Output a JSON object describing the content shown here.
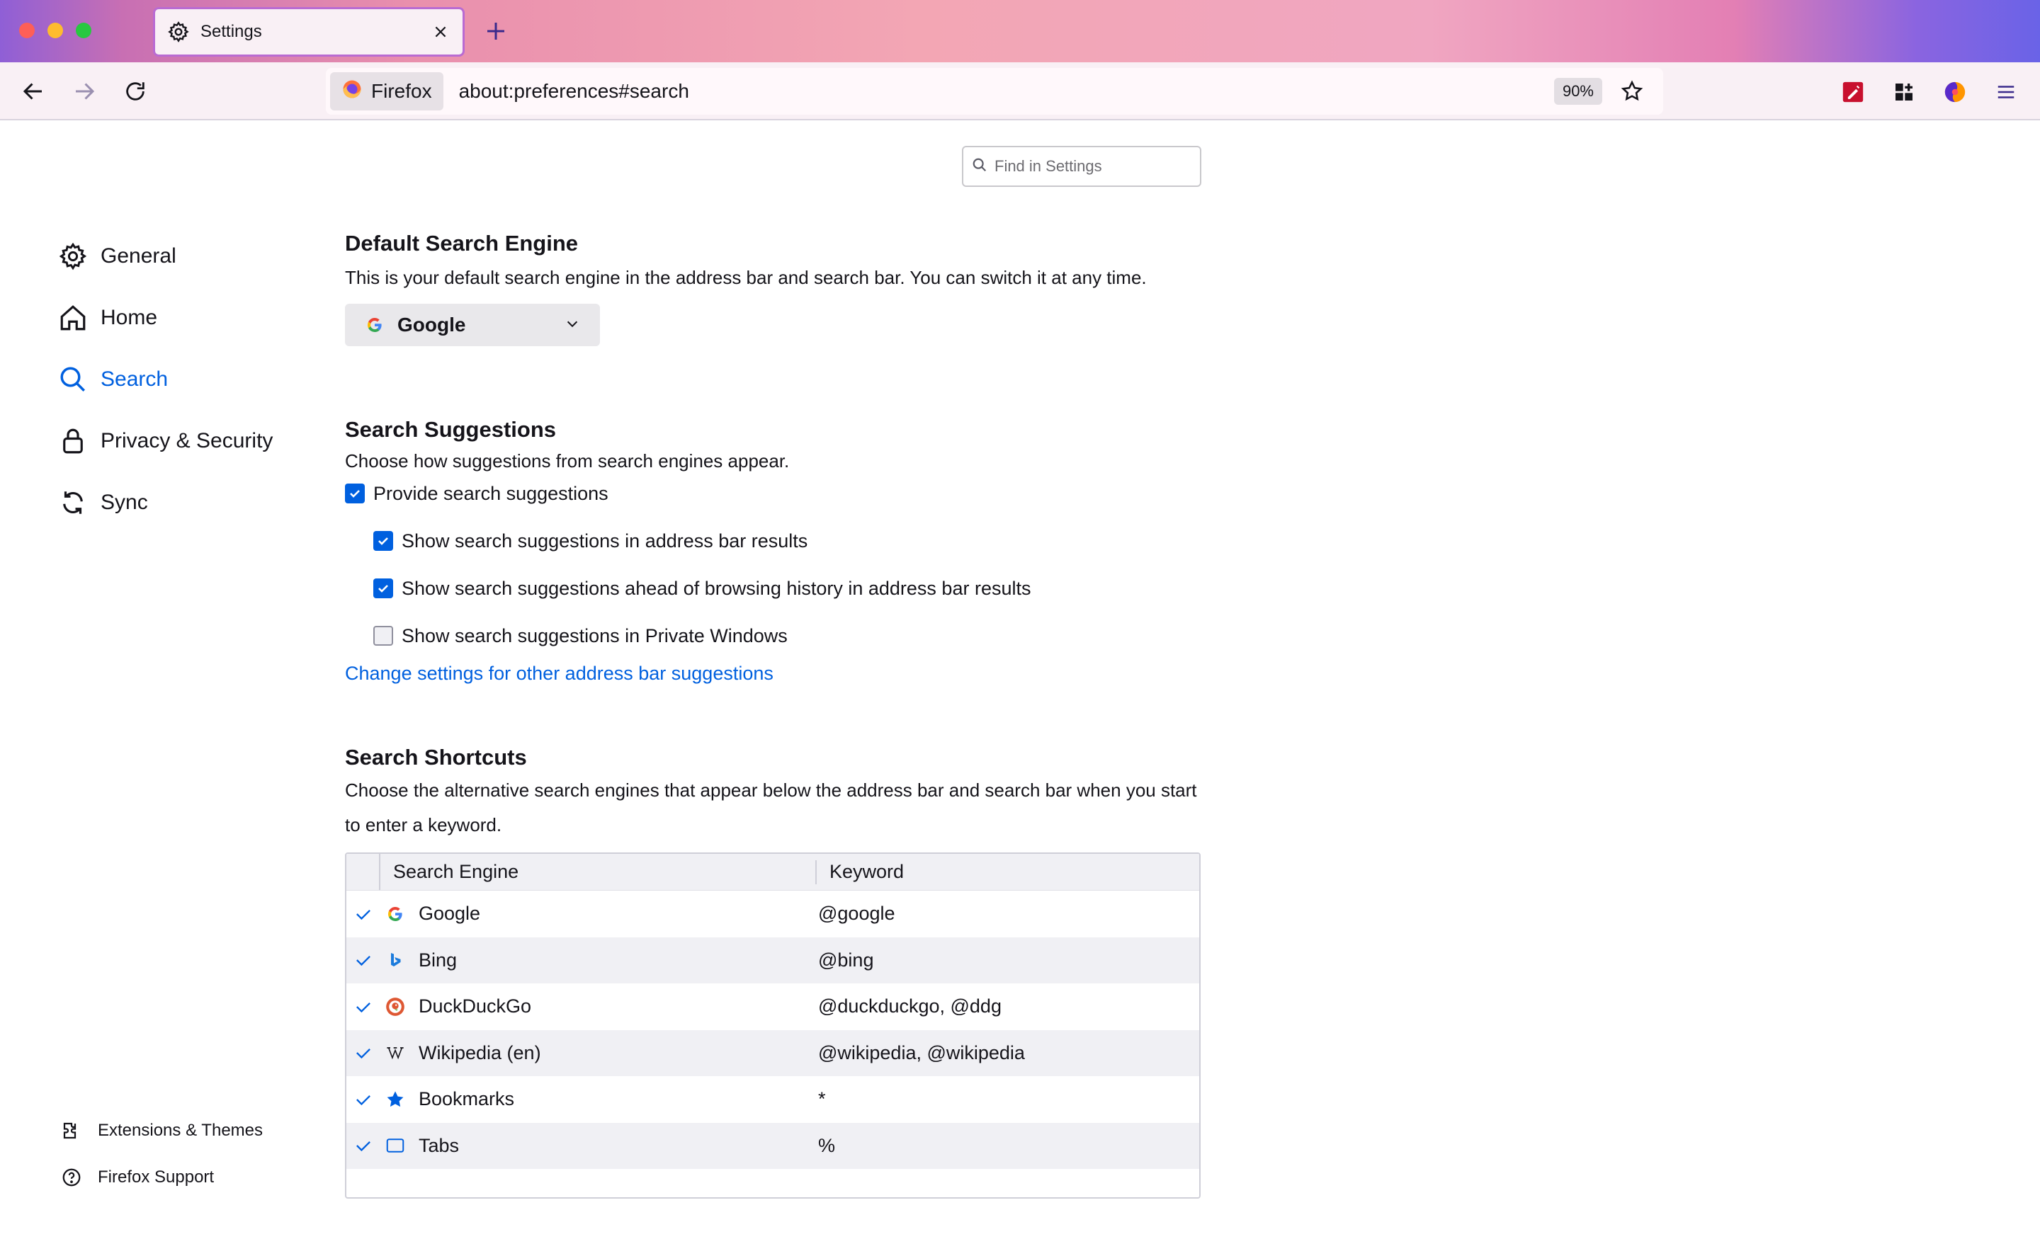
{
  "browser": {
    "tab_title": "Settings",
    "identity_label": "Firefox",
    "url": "about:preferences#search",
    "zoom": "90%"
  },
  "colors": {
    "accent": "#0060df",
    "tab_border": "#b96bd2",
    "checkbox_on": "#0060df"
  },
  "search_settings": {
    "placeholder": "Find in Settings"
  },
  "sidebar": {
    "items": [
      {
        "label": "General",
        "icon": "gear-icon",
        "active": false
      },
      {
        "label": "Home",
        "icon": "home-icon",
        "active": false
      },
      {
        "label": "Search",
        "icon": "search-icon",
        "active": true
      },
      {
        "label": "Privacy & Security",
        "icon": "lock-icon",
        "active": false
      },
      {
        "label": "Sync",
        "icon": "sync-icon",
        "active": false
      }
    ],
    "footer": [
      {
        "label": "Extensions & Themes",
        "icon": "puzzle-icon"
      },
      {
        "label": "Firefox Support",
        "icon": "help-icon"
      }
    ]
  },
  "default_engine": {
    "heading": "Default Search Engine",
    "description": "This is your default search engine in the address bar and search bar. You can switch it at any time.",
    "selected": "Google"
  },
  "suggestions": {
    "heading": "Search Suggestions",
    "description": "Choose how suggestions from search engines appear.",
    "provide": {
      "label": "Provide search suggestions",
      "checked": true
    },
    "address_bar": {
      "label": "Show search suggestions in address bar results",
      "checked": true
    },
    "ahead_history": {
      "label": "Show search suggestions ahead of browsing history in address bar results",
      "checked": true
    },
    "private": {
      "label": "Show search suggestions in Private Windows",
      "checked": false
    },
    "link": "Change settings for other address bar suggestions"
  },
  "shortcuts": {
    "heading": "Search Shortcuts",
    "description": "Choose the alternative search engines that appear below the address bar and search bar when you start to enter a keyword.",
    "columns": [
      "Search Engine",
      "Keyword"
    ],
    "rows": [
      {
        "engine": "Google",
        "keyword": "@google",
        "icon": "google-icon",
        "checked": true
      },
      {
        "engine": "Bing",
        "keyword": "@bing",
        "icon": "bing-icon",
        "checked": true
      },
      {
        "engine": "DuckDuckGo",
        "keyword": "@duckduckgo, @ddg",
        "icon": "duckduckgo-icon",
        "checked": true
      },
      {
        "engine": "Wikipedia (en)",
        "keyword": "@wikipedia, @wikipedia",
        "icon": "wikipedia-icon",
        "checked": true
      },
      {
        "engine": "Bookmarks",
        "keyword": "*",
        "icon": "bookmark-star-icon",
        "checked": true
      },
      {
        "engine": "Tabs",
        "keyword": "%",
        "icon": "tabs-icon",
        "checked": true
      }
    ]
  }
}
